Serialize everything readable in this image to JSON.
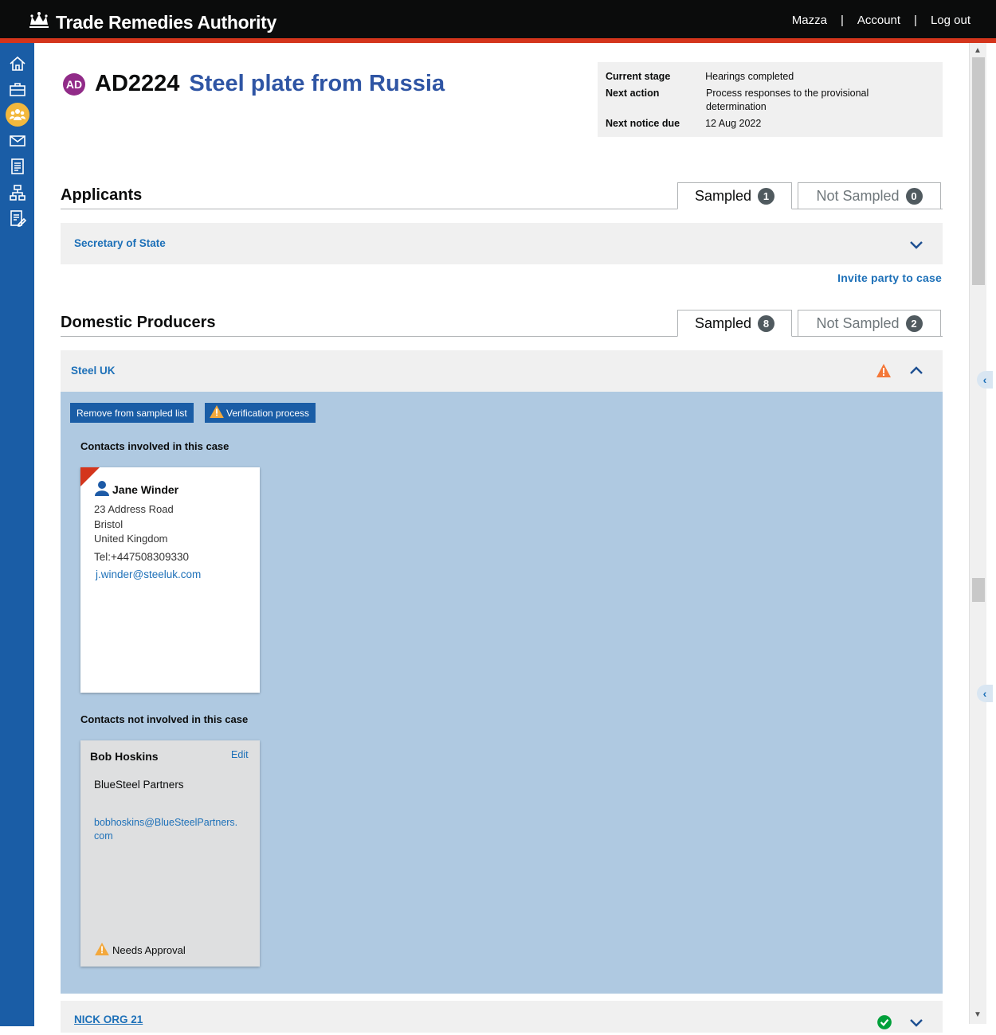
{
  "header": {
    "title": "Trade Remedies Authority",
    "nav": {
      "user": "Mazza",
      "account": "Account",
      "logout": "Log out",
      "separator": "|"
    }
  },
  "sidebar": {
    "items": [
      {
        "icon": "home-icon"
      },
      {
        "icon": "briefcase-icon"
      },
      {
        "icon": "people-icon",
        "active": true
      },
      {
        "icon": "envelope-icon"
      },
      {
        "icon": "document-icon"
      },
      {
        "icon": "sitemap-icon"
      },
      {
        "icon": "edit-document-icon"
      }
    ]
  },
  "case": {
    "badge": "AD",
    "reference": "AD2224",
    "name": "Steel plate from Russia",
    "badge_color": "#912b88"
  },
  "status": {
    "current_stage_label": "Current stage",
    "current_stage": "Hearings completed",
    "next_action_label": "Next action",
    "next_action": "Process responses to the provisional determination",
    "next_notice_label": "Next notice due",
    "next_notice": "12 Aug 2022"
  },
  "applicants": {
    "heading": "Applicants",
    "tab_sampled": "Sampled",
    "sampled_count": "1",
    "tab_not_sampled": "Not Sampled",
    "not_sampled_count": "0",
    "parties": [
      "Secretary of State"
    ],
    "invite_link": "Invite party to case"
  },
  "domestic": {
    "heading": "Domestic Producers",
    "tab_sampled": "Sampled",
    "sampled_count": "8",
    "tab_not_sampled": "Not Sampled",
    "not_sampled_count": "2",
    "expanded_party": {
      "name": "Steel UK",
      "remove_button": "Remove from sampled list",
      "verify_button": "Verification process",
      "involved_heading": "Contacts involved in this case",
      "involved_contact": {
        "name": "Jane Winder",
        "address1": "23 Address Road",
        "address2": "Bristol",
        "address3": "United Kingdom",
        "phone": "Tel:+447508309330",
        "email": "j.winder@steeluk.com"
      },
      "not_involved_heading": "Contacts not involved in this case",
      "not_involved_contact": {
        "name": "Bob Hoskins",
        "edit": "Edit",
        "org": "BlueSteel Partners",
        "email_line1": "bobhoskins@BlueSteelPartners.",
        "email_line2": "com",
        "status": "Needs Approval"
      }
    },
    "next_party": "NICK ORG 21"
  },
  "colors": {
    "accent": "#1d70b8",
    "sidebar": "#1a5da6",
    "expanded_bg": "#afc9e1",
    "warning": "#f47738",
    "success": "#00703c"
  }
}
